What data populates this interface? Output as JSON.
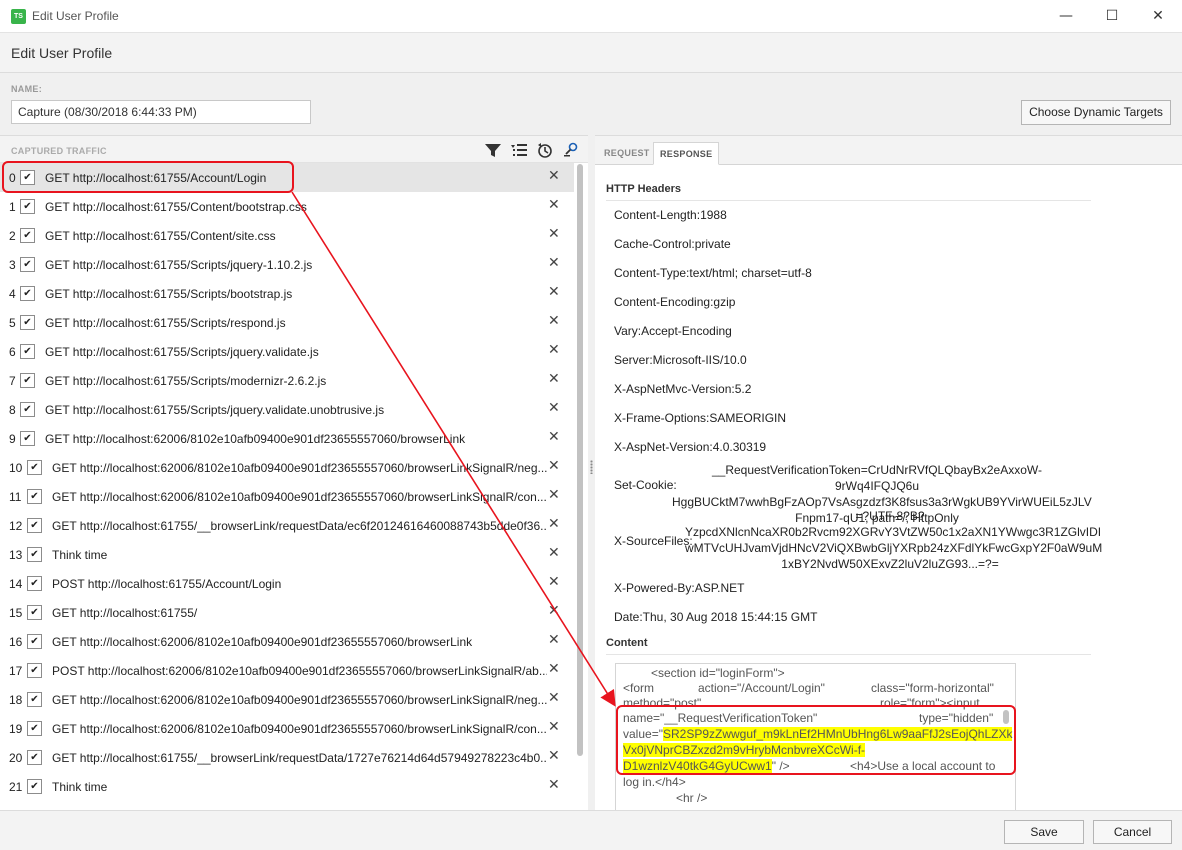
{
  "window": {
    "app_icon_text": "TS",
    "title": "Edit User Profile",
    "minimize_glyph": "—",
    "maximize_glyph": "☐",
    "close_glyph": "✕"
  },
  "header": {
    "title": "Edit User Profile"
  },
  "name_field": {
    "label": "NAME:",
    "value": "Capture (08/30/2018 6:44:33 PM)"
  },
  "choose_dynamic_targets_label": "Choose Dynamic Targets",
  "captured_traffic": {
    "label": "CAPTURED TRAFFIC",
    "toolbar_icons": [
      "filter-icon",
      "list-filter-icon",
      "history-icon",
      "find-icon"
    ],
    "remove_glyph": "✕",
    "check_glyph": "✔",
    "rows": [
      {
        "index": "0",
        "label": "GET http://localhost:61755/Account/Login"
      },
      {
        "index": "1",
        "label": "GET http://localhost:61755/Content/bootstrap.css"
      },
      {
        "index": "2",
        "label": "GET http://localhost:61755/Content/site.css"
      },
      {
        "index": "3",
        "label": "GET http://localhost:61755/Scripts/jquery-1.10.2.js"
      },
      {
        "index": "4",
        "label": "GET http://localhost:61755/Scripts/bootstrap.js"
      },
      {
        "index": "5",
        "label": "GET http://localhost:61755/Scripts/respond.js"
      },
      {
        "index": "6",
        "label": "GET http://localhost:61755/Scripts/jquery.validate.js"
      },
      {
        "index": "7",
        "label": "GET http://localhost:61755/Scripts/modernizr-2.6.2.js"
      },
      {
        "index": "8",
        "label": "GET http://localhost:61755/Scripts/jquery.validate.unobtrusive.js"
      },
      {
        "index": "9",
        "label": "GET http://localhost:62006/8102e10afb09400e901df23655557060/browserLink"
      },
      {
        "index": "10",
        "label": "GET http://localhost:62006/8102e10afb09400e901df23655557060/browserLinkSignalR/neg..."
      },
      {
        "index": "11",
        "label": "GET http://localhost:62006/8102e10afb09400e901df23655557060/browserLinkSignalR/con..."
      },
      {
        "index": "12",
        "label": "GET http://localhost:61755/__browserLink/requestData/ec6f20124616460088743b5dde0f36..."
      },
      {
        "index": "13",
        "label": "Think time"
      },
      {
        "index": "14",
        "label": "POST http://localhost:61755/Account/Login"
      },
      {
        "index": "15",
        "label": "GET http://localhost:61755/"
      },
      {
        "index": "16",
        "label": "GET http://localhost:62006/8102e10afb09400e901df23655557060/browserLink"
      },
      {
        "index": "17",
        "label": "POST http://localhost:62006/8102e10afb09400e901df23655557060/browserLinkSignalR/ab..."
      },
      {
        "index": "18",
        "label": "GET http://localhost:62006/8102e10afb09400e901df23655557060/browserLinkSignalR/neg..."
      },
      {
        "index": "19",
        "label": "GET http://localhost:62006/8102e10afb09400e901df23655557060/browserLinkSignalR/con..."
      },
      {
        "index": "20",
        "label": "GET http://localhost:61755/__browserLink/requestData/1727e76214d64d57949278223c4b0..."
      },
      {
        "index": "21",
        "label": "Think time"
      }
    ]
  },
  "tabs": {
    "request": "REQUEST",
    "response": "RESPONSE"
  },
  "response": {
    "headers_title": "HTTP Headers",
    "headers": [
      "Content-Length:1988",
      "Cache-Control:private",
      "Content-Type:text/html; charset=utf-8",
      "Content-Encoding:gzip",
      "Vary:Accept-Encoding",
      "Server:Microsoft-IIS/10.0",
      "X-AspNetMvc-Version:5.2",
      "X-Frame-Options:SAMEORIGIN",
      "X-AspNet-Version:4.0.30319"
    ],
    "set_cookie": {
      "name": "Set-Cookie:",
      "value": "__RequestVerificationToken=CrUdNrRVfQLQbayBx2eAxxoW-9rWq4IFQJQ6u\nHggBUCktM7wwhBgFzAOp7VsAsgzdzf3K8fsus3a3rWgkUB9YVirWUEiL5zJLV\nFnpm17-qU1; path=/; HttpOnly"
    },
    "source_files": {
      "name": "X-SourceFiles:",
      "value": "=?UTF-8?B?\nYzpcdXNlcnNcaXR0b2Rvcm92XGRvY3VtZW50c1x2aXN1YWwgc3R1ZGlvIDI\nwMTVcUHJvamVjdHNcV2ViQXBwbGljYXRpb24zXFdlYkFwcGxpY2F0aW9uM\n1xBY2NvdW50XExvZ2luV2luZG93...=?="
    },
    "powered_by": "X-Powered-By:ASP.NET",
    "date": "Date:Thu, 30 Aug 2018 15:44:15 GMT",
    "content_title": "Content",
    "content": {
      "line1": "<section id=\"loginForm\">",
      "line2_a": "<form",
      "line2_b": "action=\"/Account/Login\"",
      "line2_c": "class=\"form-horizontal\"",
      "line3_a": "method=\"post\"",
      "line3_b": "role=\"form\"><input",
      "line4_a": "name=\"__RequestVerificationToken\"",
      "line4_b": "type=\"hidden\"",
      "line5_prefix": "value=\"",
      "token_1": "SR2SP9zZwwguf_m9kLnEf2HMnUbHng6Lw9aaFfJ2sEojQhLZXk",
      "token_2": "Vx0jVNprCBZxzd2m9vHrybMcnbvreXCcWi-f-",
      "token_3": "D1wznlzV40tkG4GyUCww1",
      "line7_suffix": "\" />",
      "line7_b": "<h4>Use a local account to",
      "line8": "log in.</h4>",
      "line9": "<hr />"
    }
  },
  "footer": {
    "save": "Save",
    "cancel": "Cancel"
  },
  "colors": {
    "annotation_red": "#e8141e",
    "highlight_yellow": "#ffff00",
    "app_icon_green": "#38b44a"
  }
}
